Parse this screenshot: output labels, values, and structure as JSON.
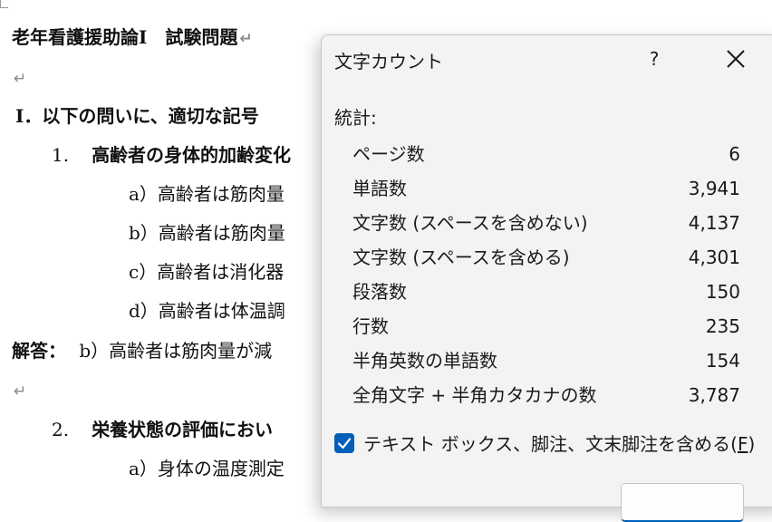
{
  "document": {
    "title": "老年看護援助論Ⅰ　試験問題",
    "section_heading": "Ⅰ．以下の問いに、適切な記号",
    "q1_number": "1.",
    "q1_text": "高齢者の身体的加齢変化",
    "q1_options": [
      "a）高齢者は筋肉量",
      "b）高齢者は筋肉量",
      "c）高齢者は消化器",
      "d）高齢者は体温調"
    ],
    "answer_label": "解答：",
    "answer_text": "b）高齢者は筋肉量が減",
    "q2_number": "2.",
    "q2_text": "栄養状態の評価におい",
    "q2_option_a": "a）身体の温度測定",
    "paragraph_mark": "↵"
  },
  "dialog": {
    "title": "文字カウント",
    "help_label": "?",
    "section_label": "統計:",
    "stats": [
      {
        "label": "ページ数",
        "value": "6"
      },
      {
        "label": "単語数",
        "value": "3,941"
      },
      {
        "label": "文字数 (スペースを含めない)",
        "value": "4,137"
      },
      {
        "label": "文字数 (スペースを含める)",
        "value": "4,301"
      },
      {
        "label": "段落数",
        "value": "150"
      },
      {
        "label": "行数",
        "value": "235"
      },
      {
        "label": "半角英数の単語数",
        "value": "154"
      },
      {
        "label": "全角文字 + 半角カタカナの数",
        "value": "3,787"
      }
    ],
    "checkbox_label": "テキスト ボックス、脚注、文末脚注を含める(",
    "checkbox_key": "F",
    "checkbox_suffix": ")",
    "checkbox_checked": true,
    "accent_color": "#005fb8"
  }
}
